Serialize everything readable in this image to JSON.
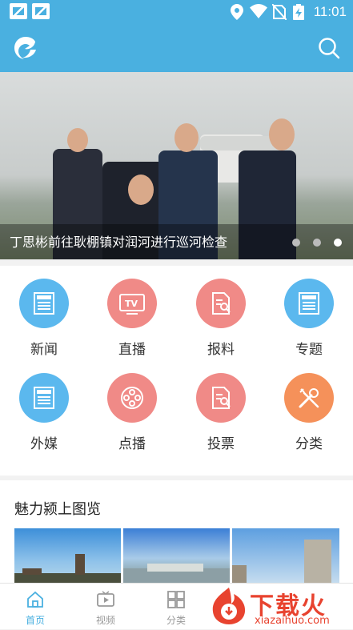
{
  "status_bar": {
    "time": "11:01",
    "icons": [
      "image-notification-icon",
      "image-notification-icon",
      "location-icon",
      "wifi-icon",
      "no-sim-icon",
      "battery-charging-icon"
    ]
  },
  "app_bar": {
    "logo_icon": "app-logo-icon",
    "search_icon": "search-icon",
    "color": "#4ab0e0"
  },
  "banner": {
    "caption": "丁思彬前往耿棚镇对润河进行巡河检查",
    "page_count": 3,
    "active_index": 3
  },
  "categories": [
    {
      "label": "新闻",
      "icon": "newspaper-icon",
      "color": "#5bb8ee"
    },
    {
      "label": "直播",
      "icon": "tv-icon",
      "color": "#f08a87"
    },
    {
      "label": "报料",
      "icon": "document-search-icon",
      "color": "#f08a87"
    },
    {
      "label": "专题",
      "icon": "newspaper-icon",
      "color": "#5bb8ee"
    },
    {
      "label": "外媒",
      "icon": "newspaper-icon",
      "color": "#5bb8ee"
    },
    {
      "label": "点播",
      "icon": "film-reel-icon",
      "color": "#f08a87"
    },
    {
      "label": "投票",
      "icon": "document-search-icon",
      "color": "#f08a87"
    },
    {
      "label": "分类",
      "icon": "tools-icon",
      "color": "#f5915a"
    }
  ],
  "gallery": {
    "title": "魅力颍上图览"
  },
  "tab_bar": {
    "tabs": [
      {
        "label": "首页",
        "icon": "home-icon",
        "active": true
      },
      {
        "label": "视频",
        "icon": "video-icon",
        "active": false
      },
      {
        "label": "分类",
        "icon": "grid-icon",
        "active": false
      }
    ]
  },
  "watermark": {
    "text": "下载火",
    "sub": "xiazaihuo.com"
  }
}
